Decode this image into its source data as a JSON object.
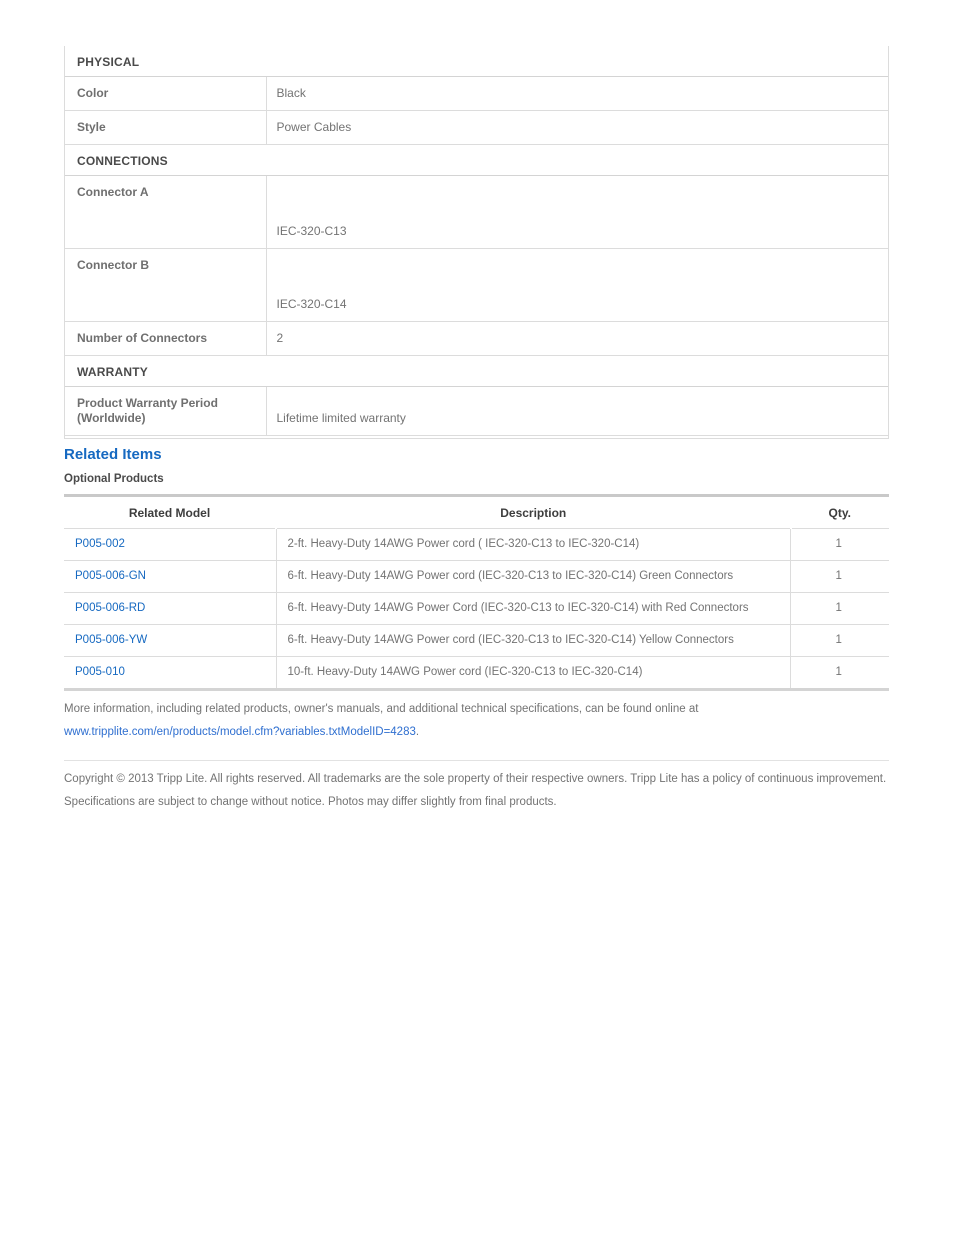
{
  "spec_table": {
    "sections": [
      {
        "heading": "PHYSICAL",
        "rows": [
          {
            "label": "Color",
            "value": "Black",
            "tall": false
          },
          {
            "label": "Style",
            "value": "Power Cables",
            "tall": false
          }
        ]
      },
      {
        "heading": "CONNECTIONS",
        "rows": [
          {
            "label": "Connector A",
            "value": "IEC-320-C13",
            "tall": true
          },
          {
            "label": "Connector B",
            "value": "IEC-320-C14",
            "tall": true
          },
          {
            "label": "Number of Connectors",
            "value": "2",
            "tall": false
          }
        ]
      },
      {
        "heading": "WARRANTY",
        "rows": [
          {
            "label": "Product Warranty Period (Worldwide)",
            "value": "Lifetime limited warranty",
            "tall": false
          }
        ]
      }
    ]
  },
  "related": {
    "heading": "Related Items",
    "subheading": "Optional Products",
    "columns": [
      "Related Model",
      "Description",
      "Qty."
    ],
    "rows": [
      {
        "model": "P005-002",
        "description": "2-ft. Heavy-Duty 14AWG Power cord ( IEC-320-C13 to IEC-320-C14)",
        "qty": "1"
      },
      {
        "model": "P005-006-GN",
        "description": "6-ft. Heavy-Duty 14AWG Power cord (IEC-320-C13 to IEC-320-C14) Green Connectors",
        "qty": "1"
      },
      {
        "model": "P005-006-RD",
        "description": "6-ft. Heavy-Duty 14AWG Power Cord (IEC-320-C13 to IEC-320-C14) with Red Connectors",
        "qty": "1"
      },
      {
        "model": "P005-006-YW",
        "description": "6-ft. Heavy-Duty 14AWG Power cord (IEC-320-C13 to IEC-320-C14) Yellow Connectors",
        "qty": "1"
      },
      {
        "model": "P005-010",
        "description": "10-ft. Heavy-Duty 14AWG Power cord (IEC-320-C13 to IEC-320-C14)",
        "qty": "1"
      }
    ]
  },
  "footnote": {
    "more_info_text": "More information, including related products, owner's manuals, and additional technical specifications, can be found online at",
    "more_info_url": "www.tripplite.com/en/products/model.cfm?variables.txtModelID=4283",
    "more_info_url_suffix": ".",
    "copyright": "Copyright © 2013 Tripp Lite. All rights reserved. All trademarks are the sole property of their respective owners. Tripp Lite has a policy of continuous improvement. Specifications are subject to change without notice. Photos may differ slightly from final products."
  },
  "colors": {
    "heading_blue": "#1669c1",
    "link_blue": "#1669c1",
    "url_blue": "#2f6fd0",
    "border_gray": "#dcdcdc",
    "text_gray": "#737373",
    "label_gray": "#6f6f6f"
  }
}
